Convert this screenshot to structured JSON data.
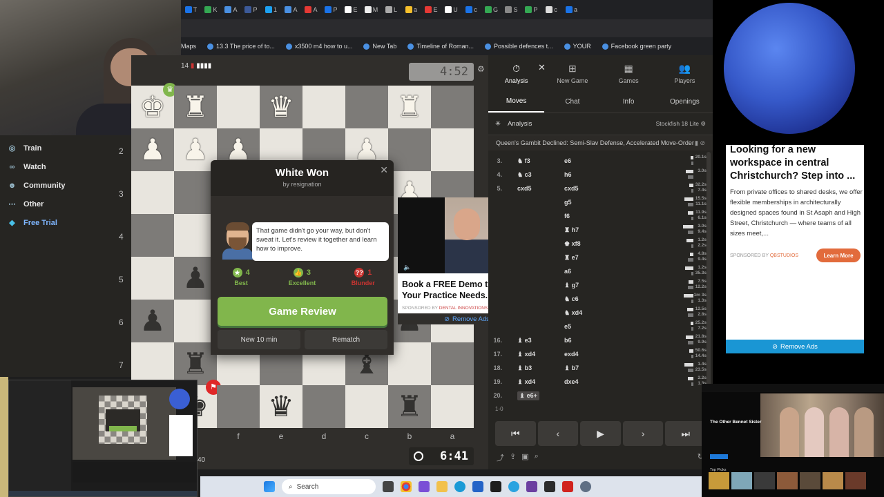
{
  "browser": {
    "tabs": [
      "T",
      "K",
      "A",
      "P",
      "1",
      "A",
      "A",
      "P",
      "E",
      "M",
      "L",
      "a",
      "E",
      "U",
      "c",
      "G",
      "S",
      "P",
      "c",
      "a"
    ],
    "bookmarks": [
      {
        "label": "Maps"
      },
      {
        "label": "13.3 The price of to..."
      },
      {
        "label": "x3500 m4 how to u..."
      },
      {
        "label": "New Tab"
      },
      {
        "label": "Timeline of Roman..."
      },
      {
        "label": "Possible defences t..."
      },
      {
        "label": "YOUR"
      },
      {
        "label": "Facebook green party"
      }
    ]
  },
  "sidebar": {
    "items": [
      {
        "label": "Train",
        "icon": "target-icon"
      },
      {
        "label": "Watch",
        "icon": "binoculars-icon"
      },
      {
        "label": "Community",
        "icon": "people-icon"
      },
      {
        "label": "Other",
        "icon": "more-dots-icon"
      },
      {
        "label": "Free Trial",
        "icon": "diamond-icon"
      }
    ]
  },
  "game": {
    "top_player_label": "14",
    "top_clock": "4:52",
    "bottom_clock": "6:41",
    "bottom_rating_fragment": "40",
    "ranks": [
      "2",
      "3",
      "4",
      "5",
      "6",
      "7"
    ],
    "files": [
      "f",
      "e",
      "d",
      "c",
      "b",
      "a"
    ],
    "board": [
      [
        "wK",
        "wR",
        "",
        "wQ",
        "",
        "",
        "wR",
        ""
      ],
      [
        "wP",
        "wP",
        "wP",
        "",
        "",
        "wP",
        "",
        ""
      ],
      [
        "",
        "",
        "",
        "",
        "",
        "",
        "wP",
        ""
      ],
      [
        "",
        "",
        "",
        "",
        "",
        "",
        "",
        ""
      ],
      [
        "",
        "bP",
        "",
        "",
        "",
        "",
        "",
        ""
      ],
      [
        "bP",
        "",
        "",
        "",
        "",
        "bP",
        "bP",
        ""
      ],
      [
        "",
        "bR",
        "",
        "",
        "",
        "bB",
        "",
        ""
      ],
      [
        "bR",
        "bK",
        "",
        "bQ",
        "",
        "",
        "bR",
        ""
      ]
    ]
  },
  "modal": {
    "title": "White Won",
    "subtitle": "by resignation",
    "coach_message": "That game didn't go your way, but don't sweat it. Let's review it together and learn how to improve.",
    "stats": [
      {
        "value": "4",
        "label": "Best",
        "color": "#81b64c",
        "icon": "star-icon"
      },
      {
        "value": "3",
        "label": "Excellent",
        "color": "#81b64c",
        "icon": "thumbs-up-icon"
      },
      {
        "value": "1",
        "label": "Blunder",
        "color": "#ca3431",
        "icon": "double-question-icon"
      }
    ],
    "review_button": "Game Review",
    "new_game_button": "New 10 min",
    "rematch_button": "Rematch"
  },
  "mid_ad": {
    "title": "Book a FREE Demo to Discuss Your Practice Needs.",
    "sponsor_prefix": "SPONSORED BY",
    "sponsor": "DENTAL INNOVATIONS",
    "remove": "Remove Ads"
  },
  "panel": {
    "top_tabs": [
      {
        "label": "Analysis",
        "icon": "stopwatch-icon"
      },
      {
        "label": "New Game",
        "icon": "plus-square-icon"
      },
      {
        "label": "Games",
        "icon": "board-icon"
      },
      {
        "label": "Players",
        "icon": "players-icon"
      }
    ],
    "sub_tabs": [
      "Moves",
      "Chat",
      "Info",
      "Openings"
    ],
    "analysis_label": "Analysis",
    "engine": "Stockfish 18 Lite",
    "opening": "Queen's Gambit Declined: Semi-Slav Defense, Accelerated Move-Order",
    "moves": [
      {
        "no": "3.",
        "white": "f3",
        "black": "e6",
        "t1": "",
        "t2": "20.1s",
        "p1": "N",
        "p2": ""
      },
      {
        "no": "4.",
        "white": "c3",
        "black": "h6",
        "t1": "",
        "t2": "3.0s",
        "p1": "N",
        "p2": ""
      },
      {
        "no": "5.",
        "white": "cxd5",
        "black": "cxd5",
        "t1": "32.2s",
        "t2": "7.4s",
        "p1": "",
        "p2": ""
      },
      {
        "no": "",
        "white": "",
        "black": "g5",
        "t1": "15.5s",
        "t2": "11.1s",
        "p1": "",
        "p2": ""
      },
      {
        "no": "",
        "white": "",
        "black": "f6",
        "t1": "11.9s",
        "t2": "6.1s",
        "p1": "",
        "p2": ""
      },
      {
        "no": "",
        "white": "",
        "black": "h7",
        "t1": "3.0s",
        "t2": "9.4s",
        "p1": "",
        "p2": "R"
      },
      {
        "no": "",
        "white": "",
        "black": "xf8",
        "t1": "1.2s",
        "t2": "2.2s",
        "p1": "",
        "p2": "K"
      },
      {
        "no": "",
        "white": "",
        "black": "e7",
        "t1": "4.8s",
        "t2": "9.4s",
        "p1": "",
        "p2": "R"
      },
      {
        "no": "",
        "white": "",
        "black": "a6",
        "t1": "1.2s",
        "t2": "35.3s",
        "p1": "",
        "p2": ""
      },
      {
        "no": "",
        "white": "",
        "black": "g7",
        "t1": "7.5s",
        "t2": "12.2s",
        "p1": "",
        "p2": "B"
      },
      {
        "no": "",
        "white": "",
        "black": "c6",
        "t1": "1m 3s",
        "t2": "1.3s",
        "p1": "",
        "p2": "N"
      },
      {
        "no": "",
        "white": "",
        "black": "xd4",
        "t1": "12.5s",
        "t2": "2.8s",
        "p1": "",
        "p2": "N"
      },
      {
        "no": "",
        "white": "",
        "black": "e5",
        "t1": "25.2s",
        "t2": "7.2s",
        "p1": "",
        "p2": ""
      },
      {
        "no": "16.",
        "white": "e3",
        "black": "b6",
        "t1": "21.8s",
        "t2": "9.9s",
        "p1": "B",
        "p2": ""
      },
      {
        "no": "17.",
        "white": "xd4",
        "black": "exd4",
        "t1": "50.6s",
        "t2": "14.4s",
        "p1": "B",
        "p2": ""
      },
      {
        "no": "18.",
        "white": "b3",
        "black": "b7",
        "t1": "1.4s",
        "t2": "23.5s",
        "p1": "B",
        "p2": "B"
      },
      {
        "no": "19.",
        "white": "xd4",
        "black": "dxe4",
        "t1": "2.2s",
        "t2": "1.3s",
        "p1": "B",
        "p2": ""
      },
      {
        "no": "20.",
        "white": "e6+",
        "black": "",
        "t1": "",
        "t2": "",
        "p1": "B",
        "p2": ""
      }
    ],
    "result": "1-0"
  },
  "right_ad": {
    "title": "Looking for a new workspace in central Christchurch? Step into ...",
    "body": "From private offices to shared desks, we offer flexible memberships in architecturally designed spaces found in St Asaph and High Street, Christchurch — where teams of all sizes meet,...",
    "sponsor_prefix": "SPONSORED BY",
    "sponsor": "QBSTUDIOS",
    "cta": "Learn More",
    "remove": "Remove Ads"
  },
  "tv": {
    "title": "The Other Bennet Sister",
    "top_picks": "Top Picks"
  },
  "taskbar": {
    "search_placeholder": "Search"
  }
}
